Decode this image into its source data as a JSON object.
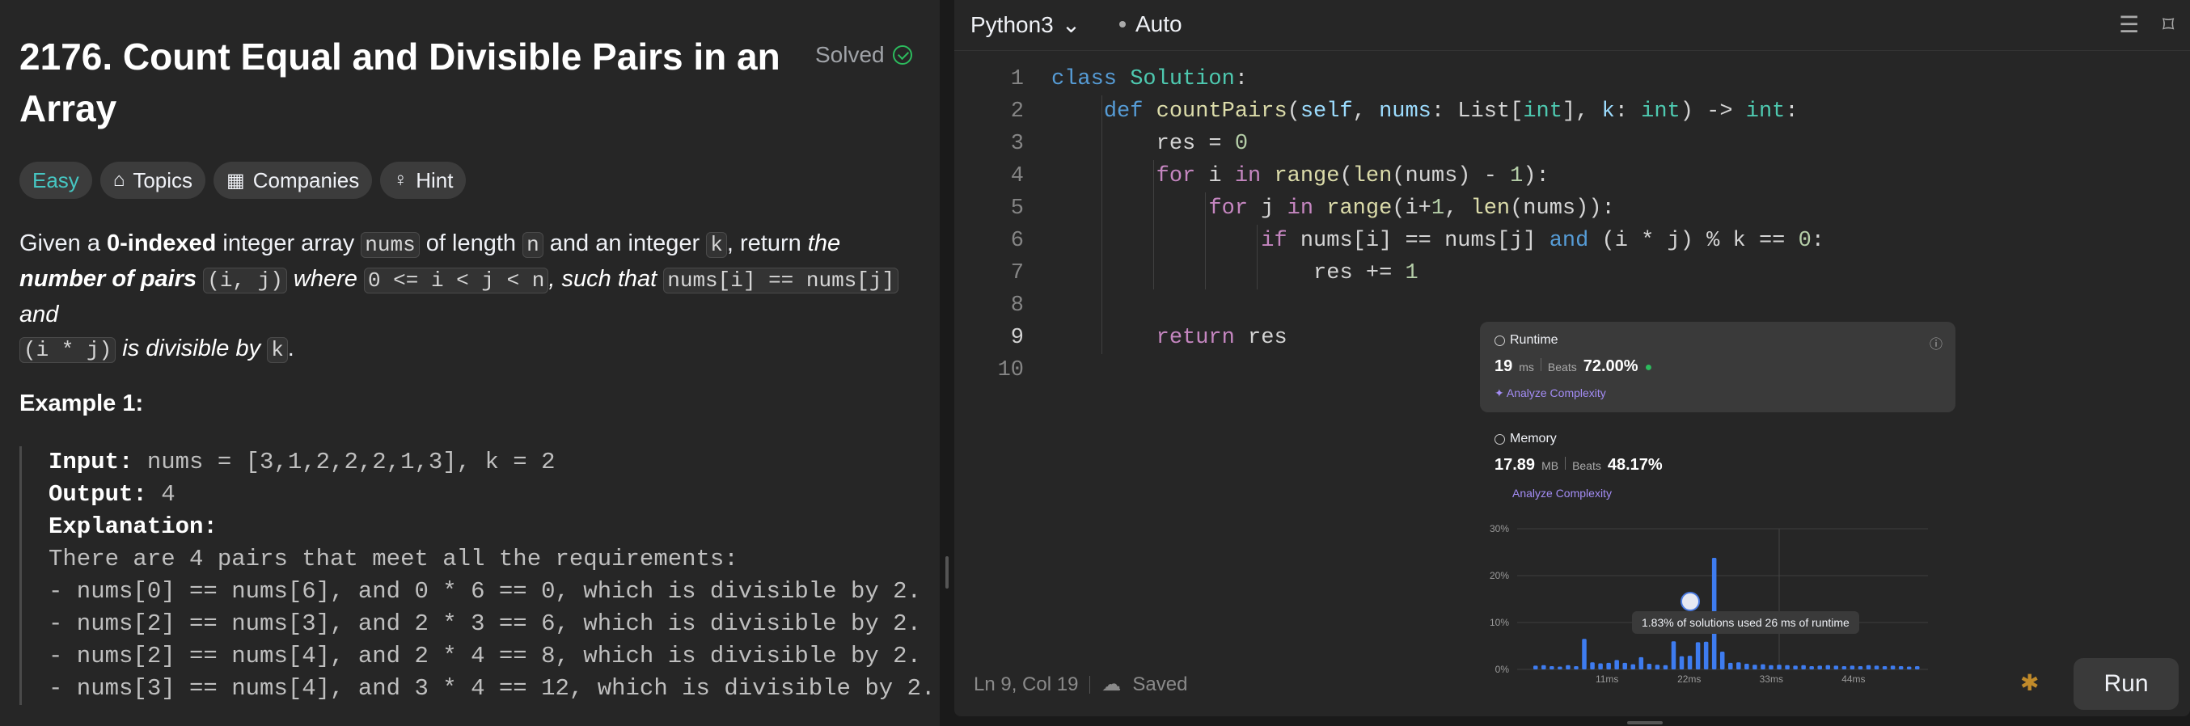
{
  "problem": {
    "title": "2176. Count Equal and Divisible Pairs in an Array",
    "solved_label": "Solved",
    "tags": {
      "difficulty": "Easy",
      "topics": "Topics",
      "companies": "Companies",
      "hint": "Hint"
    },
    "description": {
      "p1": "Given a ",
      "p2": "0-indexed",
      "p3": " integer array ",
      "c1": "nums",
      "p4": " of length ",
      "c2": "n",
      "p5": " and an integer ",
      "c3": "k",
      "p6": ", return ",
      "p7": "the",
      "p8": "number of pairs",
      "c4": "(i, j)",
      "p9": " where ",
      "c5": "0 <= i < j < n",
      "p10": ", such that ",
      "c6": "nums[i] == nums[j]",
      "p11": " and",
      "c7": "(i * j)",
      "p12": " is divisible by ",
      "c8": "k",
      "p13": "."
    },
    "example": {
      "title": "Example 1:",
      "input_label": "Input:",
      "input_value": " nums = [3,1,2,2,2,1,3], k = 2",
      "output_label": "Output:",
      "output_value": " 4",
      "explanation_label": "Explanation:",
      "lines": [
        "There are 4 pairs that meet all the requirements:",
        "- nums[0] == nums[6], and 0 * 6 == 0, which is divisible by 2.",
        "- nums[2] == nums[3], and 2 * 3 == 6, which is divisible by 2.",
        "- nums[2] == nums[4], and 2 * 4 == 8, which is divisible by 2.",
        "- nums[3] == nums[4], and 3 * 4 == 12, which is divisible by 2."
      ]
    }
  },
  "editor": {
    "language": "Python3",
    "mode": "Auto",
    "line_numbers": [
      "1",
      "2",
      "3",
      "4",
      "5",
      "6",
      "7",
      "8",
      "9",
      "10"
    ],
    "status_position": "Ln 9, Col 19",
    "status_saved": "Saved",
    "run_label": "Run"
  },
  "runtime": {
    "label": "Runtime",
    "value": "19",
    "unit": "ms",
    "beats_label": "Beats",
    "beats_value": "72.00%",
    "analyze": "Analyze Complexity"
  },
  "memory": {
    "label": "Memory",
    "value": "17.89",
    "unit": "MB",
    "beats_label": "Beats",
    "beats_value": "48.17%",
    "analyze": "Analyze Complexity"
  },
  "tooltip": "1.83% of solutions used 26 ms of runtime",
  "colors": {
    "accent_green": "#2cbb5d",
    "easy": "#46c6c2",
    "bar": "#3e7cf0",
    "analyze": "#a38cf4"
  },
  "chart_data": {
    "type": "bar",
    "y_ticks": [
      "30%",
      "20%",
      "10%",
      "0%"
    ],
    "x_ticks": [
      "11ms",
      "22ms",
      "33ms",
      "44ms"
    ],
    "ylim": [
      0,
      30
    ],
    "values": [
      0.8,
      0.9,
      0.7,
      0.6,
      0.9,
      0.7,
      6.5,
      1.5,
      1.3,
      1.4,
      2.0,
      1.4,
      1.1,
      2.6,
      1.2,
      1.0,
      0.9,
      6.0,
      2.8,
      2.9,
      5.8,
      5.9,
      23.8,
      3.8,
      1.4,
      1.5,
      1.2,
      1.0,
      1.1,
      0.9,
      1.0,
      0.9,
      0.8,
      0.9,
      0.7,
      0.8,
      0.9,
      0.8,
      0.7,
      0.8,
      0.7,
      0.9,
      0.8,
      0.7,
      0.8,
      0.7,
      0.6,
      0.7
    ]
  }
}
